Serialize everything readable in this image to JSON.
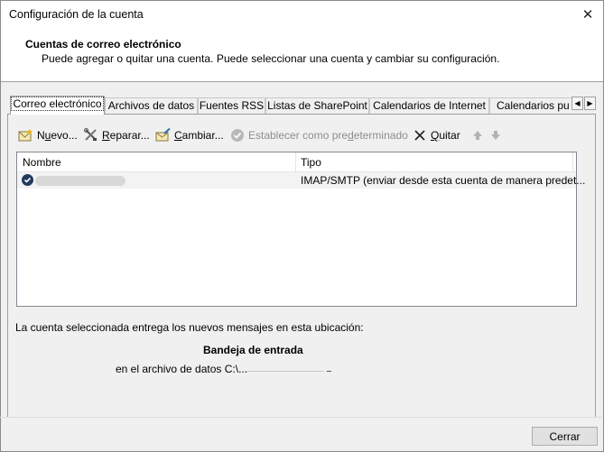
{
  "window": {
    "title": "Configuración de la cuenta",
    "close_glyph": "✕"
  },
  "header": {
    "title": "Cuentas de correo electrónico",
    "description": "Puede agregar o quitar una cuenta. Puede seleccionar una cuenta y cambiar su configuración."
  },
  "tabs": [
    {
      "label": "Correo electrónico",
      "active": true
    },
    {
      "label": "Archivos de datos"
    },
    {
      "label": "Fuentes RSS"
    },
    {
      "label": "Listas de SharePoint"
    },
    {
      "label": "Calendarios de Internet"
    },
    {
      "label": "Calendarios pu"
    }
  ],
  "toolbar": {
    "new_label_pre": "N",
    "new_label_u": "u",
    "new_label_post": "evo...",
    "repair_label_pre": "",
    "repair_label_u": "R",
    "repair_label_post": "eparar...",
    "change_label_pre": "",
    "change_label_u": "C",
    "change_label_post": "ambiar...",
    "set_default_pre": "Establecer como pre",
    "set_default_u": "d",
    "set_default_post": "eterminado",
    "remove_label_pre": "",
    "remove_label_u": "Q",
    "remove_label_post": "uitar"
  },
  "list": {
    "columns": [
      "Nombre",
      "Tipo"
    ],
    "rows": [
      {
        "type": "IMAP/SMTP (enviar desde esta cuenta de manera predet..."
      }
    ]
  },
  "details": {
    "info": "La cuenta seleccionada entrega los nuevos mensajes en esta ubicación:",
    "folder": "Bandeja de entrada",
    "path": "en el archivo de datos C:\\..."
  },
  "footer": {
    "close_label": "Cerrar"
  }
}
